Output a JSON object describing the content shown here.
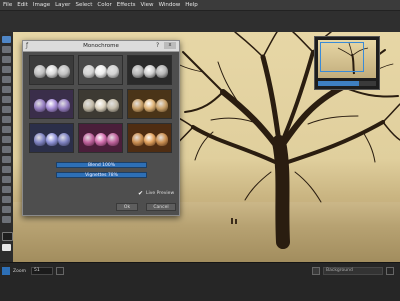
{
  "menubar": {
    "items": [
      "File",
      "Edit",
      "Image",
      "Layer",
      "Select",
      "Color",
      "Effects",
      "View",
      "Window",
      "Help"
    ]
  },
  "dialog": {
    "title": "Monochrome",
    "help_label": "?",
    "close_label": "x",
    "presets": [
      {
        "name": "neutral",
        "bg": "#3b3b3b",
        "tint": "#d8d8d8"
      },
      {
        "name": "neutral-light",
        "bg": "#4a4a4a",
        "tint": "#ececec"
      },
      {
        "name": "neutral-dark",
        "bg": "#2a2a2a",
        "tint": "#cfcfcf"
      },
      {
        "name": "purple",
        "bg": "#3a2e4a",
        "tint": "#a88fd8"
      },
      {
        "name": "sepia-grey",
        "bg": "#3d3a33",
        "tint": "#dcd3bf"
      },
      {
        "name": "sepia",
        "bg": "#4a3418",
        "tint": "#e0b57a"
      },
      {
        "name": "blue",
        "bg": "#2b2f49",
        "tint": "#8f93d8"
      },
      {
        "name": "magenta",
        "bg": "#4a1e3a",
        "tint": "#d36fae"
      },
      {
        "name": "copper",
        "bg": "#4f2d12",
        "tint": "#e1a25f"
      }
    ],
    "blend_label": "Blend 100%",
    "vignettes_label": "Vignettes 78%",
    "checkbox_label": "Live Preview",
    "checkbox_checked": true,
    "ok_label": "Ok",
    "cancel_label": "Cancel"
  },
  "status": {
    "zoom_label": "Zoom",
    "zoom_value": "51",
    "layer_value": "Background"
  },
  "colors": {
    "accent": "#2d6fb6",
    "sepia_light": "#e7d7a6",
    "tree_dark": "#2a1d10"
  }
}
